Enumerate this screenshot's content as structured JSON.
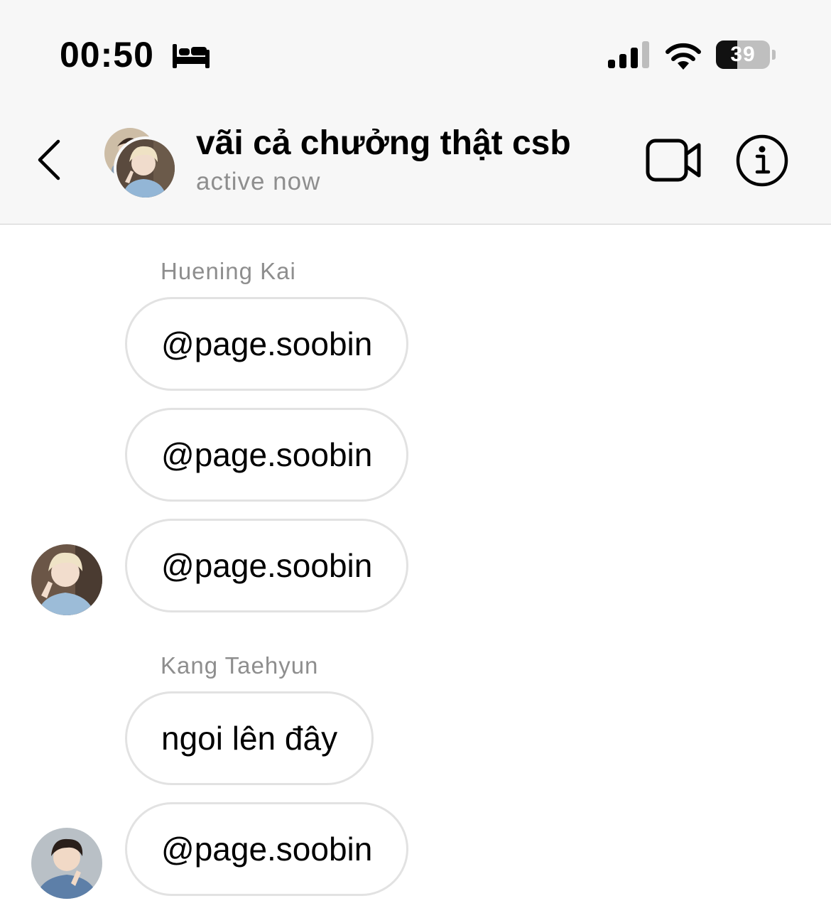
{
  "status_bar": {
    "time": "00:50",
    "sleep_icon": "bed-icon",
    "signal_icon": "cellular-signal-icon",
    "wifi_icon": "wifi-icon",
    "battery_level": "39",
    "battery_fraction": 0.39
  },
  "header": {
    "back_icon": "chevron-left-icon",
    "title": "vãi cả chưởng thật csb",
    "status": "active now",
    "video_icon": "video-camera-icon",
    "info_icon": "info-icon"
  },
  "messages": [
    {
      "sender": "Huening Kai",
      "text": "@page.soobin"
    },
    {
      "text": "@page.soobin"
    },
    {
      "text": "@page.soobin",
      "avatar": "avatar-huening-kai"
    },
    {
      "sender": "Kang Taehyun",
      "text": "ngoi lên đây"
    },
    {
      "text": "@page.soobin",
      "avatar": "avatar-kang-taehyun"
    }
  ],
  "colors": {
    "header_bg": "#f7f7f7",
    "secondary_text": "#8e8e8e",
    "bubble_border": "#e2e2e2"
  }
}
